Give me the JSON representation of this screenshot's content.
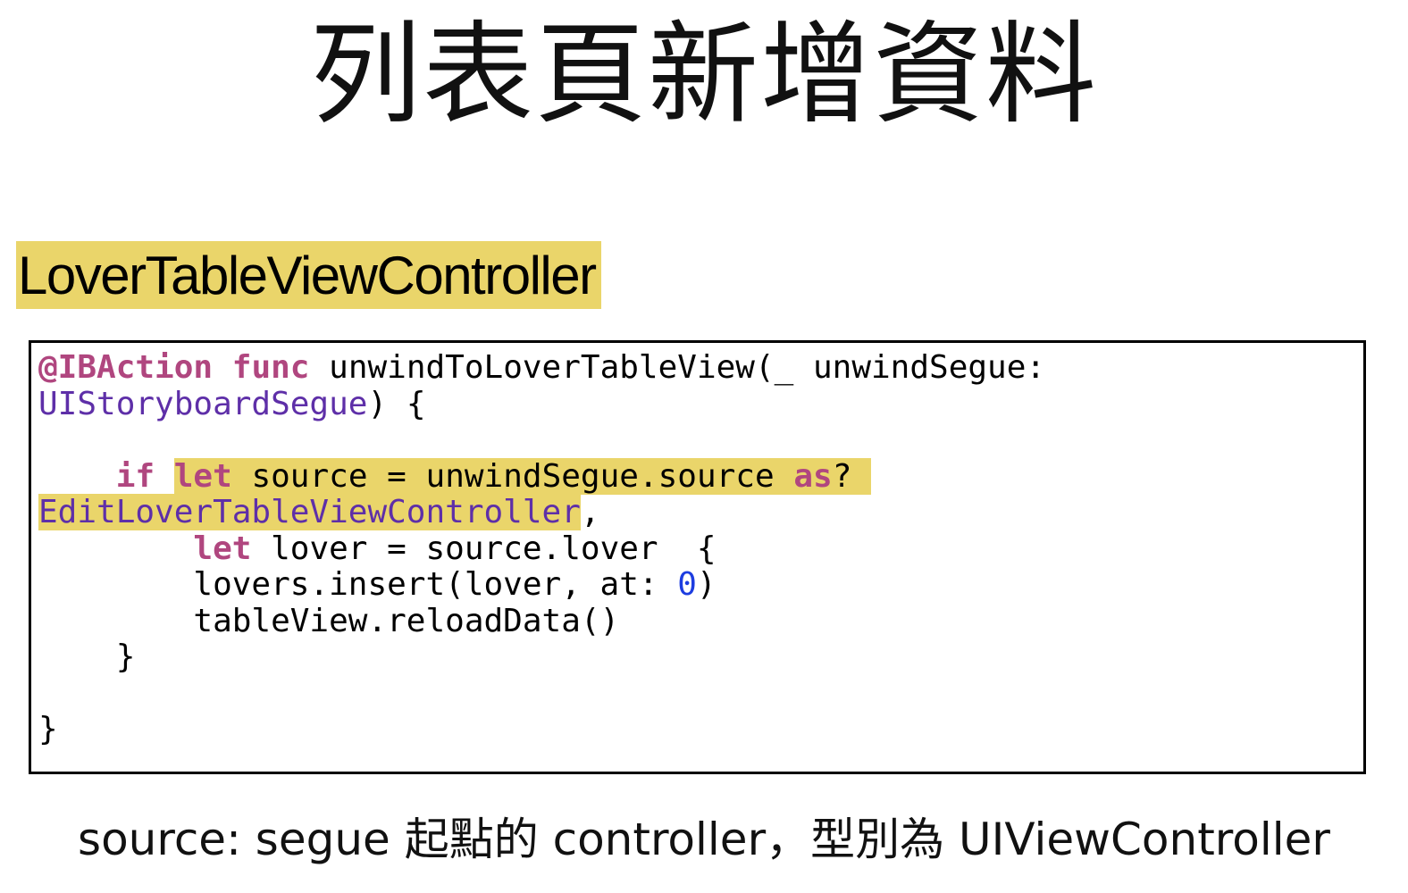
{
  "title": "列表頁新增資料",
  "class_label": "LoverTableViewController",
  "code": {
    "tok_ibaction": "@IBAction",
    "tok_func": "func",
    "tok_fn_sig": " unwindToLoverTableView(_ unwindSegue:",
    "tok_type_storyboard": "UIStoryboardSegue",
    "tok_sig_end": ") {",
    "tok_indent_if": "    ",
    "tok_if": "if",
    "tok_space": " ",
    "tok_let1": "let",
    "tok_source_expr": " source = unwindSegue.source ",
    "tok_as": "as",
    "tok_q": "? ",
    "tok_type_edit": "EditLoverTableViewController",
    "tok_comma": ",",
    "tok_indent_let": "       ",
    "tok_let2": "let",
    "tok_lover_expr": " lover = source.lover  {",
    "tok_insert_a": "        lovers.insert(lover, at: ",
    "tok_zero": "0",
    "tok_insert_b": ")",
    "tok_reload": "        tableView.reloadData()",
    "tok_close_inner": "    }",
    "tok_close_outer": "}"
  },
  "caption": "source: segue 起點的 controller，型別為 UIViewController",
  "colors": {
    "highlight": "#ead56a",
    "keyword": "#b0467f",
    "type": "#5e2fa8",
    "number": "#1d3de0"
  }
}
